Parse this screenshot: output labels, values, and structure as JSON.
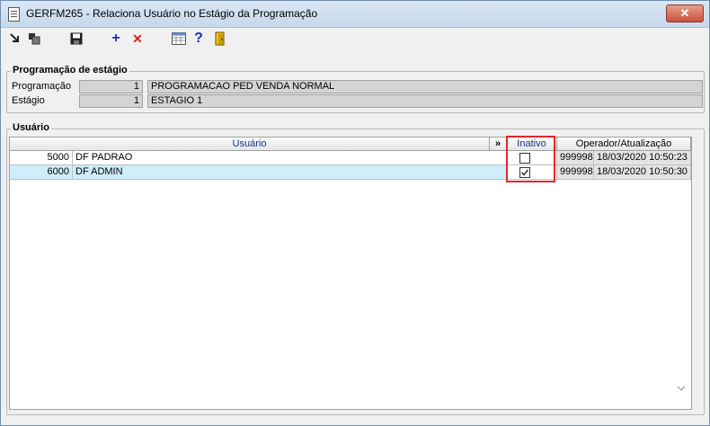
{
  "window": {
    "title": "GERFM265 - Relaciona Usuário no Estágio da Programação",
    "close_label": "✕"
  },
  "toolbar": {
    "icons": [
      "import-icon",
      "copy-icon",
      "save-icon",
      "add-icon",
      "delete-icon",
      "calendar-icon",
      "help-icon",
      "exit-icon"
    ],
    "add_glyph": "+",
    "delete_glyph": "✕",
    "help_glyph": "?"
  },
  "programacao_group": {
    "label": "Programação de estágio",
    "programacao_label": "Programação",
    "programacao_code": "1",
    "programacao_desc": "PROGRAMACAO PED VENDA NORMAL",
    "estagio_label": "Estágio",
    "estagio_code": "1",
    "estagio_desc": "ESTAGIO 1"
  },
  "usuario_group": {
    "label": "Usuário",
    "columns": {
      "usuario": "Usuário",
      "expand": "»",
      "inativo": "Inativo",
      "operador": "Operador/Atualização"
    },
    "rows": [
      {
        "code": "5000",
        "name": "DF PADRAO",
        "inativo": false,
        "operador": "999998",
        "atualizacao": "18/03/2020 10:50:23"
      },
      {
        "code": "6000",
        "name": "DF ADMIN",
        "inativo": true,
        "operador": "999998",
        "atualizacao": "18/03/2020 10:50:30"
      }
    ]
  },
  "colors": {
    "selected_row": "#cdeefa",
    "highlight_box": "#e3262b",
    "header_text": "#1a2e8a"
  }
}
